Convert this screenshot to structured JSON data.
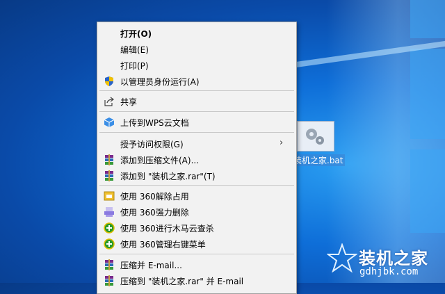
{
  "menu": {
    "items": [
      {
        "label": "打开(O)",
        "bold": true
      },
      {
        "label": "编辑(E)"
      },
      {
        "label": "打印(P)"
      },
      {
        "label": "以管理员身份运行(A)"
      },
      {
        "label": "共享"
      },
      {
        "label": "上传到WPS云文档"
      },
      {
        "label": "授予访问权限(G)"
      },
      {
        "label": "添加到压缩文件(A)..."
      },
      {
        "label": "添加到 \"装机之家.rar\"(T)"
      },
      {
        "label": "使用 360解除占用"
      },
      {
        "label": "使用 360强力删除"
      },
      {
        "label": "使用 360进行木马云查杀"
      },
      {
        "label": "使用 360管理右键菜单"
      },
      {
        "label": "压缩并 E-mail..."
      },
      {
        "label": "压缩到 \"装机之家.rar\" 并 E-mail"
      }
    ],
    "submenu_arrow": "›"
  },
  "desktop": {
    "file_label": "装机之家.bat"
  },
  "watermark": {
    "title": "装机之家",
    "url": "gdhjbk.com"
  },
  "colors": {
    "menu_bg": "#f2f2f2",
    "desktop_blue": "#0e6ed8"
  }
}
